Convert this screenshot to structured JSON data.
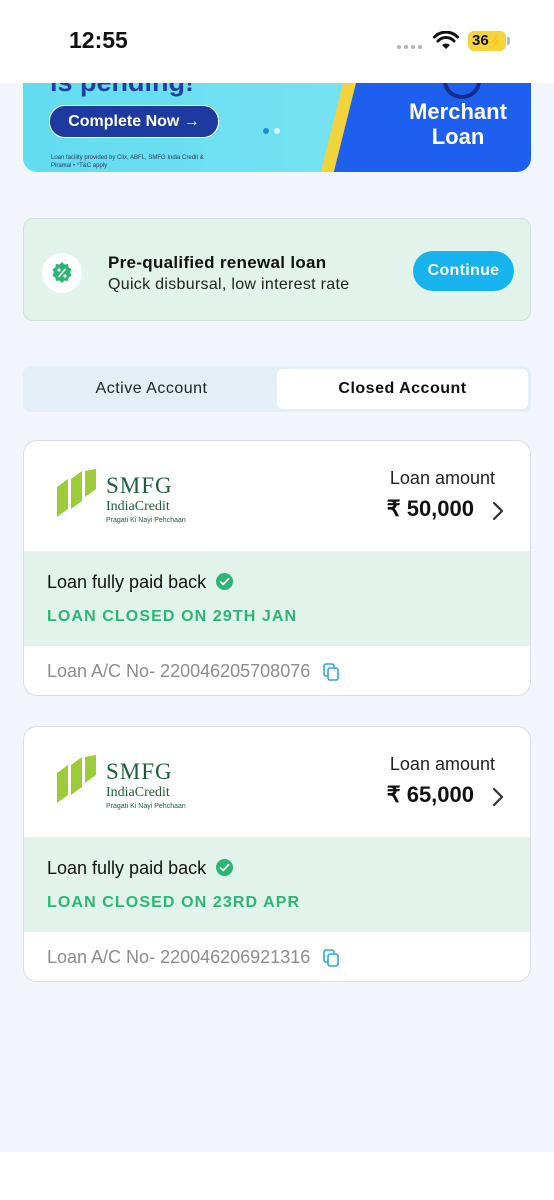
{
  "status_bar": {
    "time": "12:55",
    "battery": "36"
  },
  "banner": {
    "heading": "is pending!",
    "cta_label": "Complete Now →",
    "disclaimer": "Loan facility provided by Clix, ABFL, SMFG India Credit & Piramal • *T&C apply",
    "promo_title": "Merchant Loan"
  },
  "renewal": {
    "title": "Pre-qualified renewal loan",
    "subtitle": "Quick disbursal, low interest rate",
    "continue_label": "Continue"
  },
  "tabs": [
    {
      "label": "Active Account",
      "active": false
    },
    {
      "label": "Closed Account",
      "active": true
    }
  ],
  "loans": [
    {
      "lender_name": "SMFG",
      "lender_sub": "IndiaCredit",
      "lender_tagline": "Pragati Ki Nayi Pehchaan",
      "amount_label": "Loan amount",
      "amount": "₹ 50,000",
      "status": "Loan fully paid back",
      "closed_on": "LOAN CLOSED ON 29TH JAN",
      "account": "Loan A/C No- 220046205708076"
    },
    {
      "lender_name": "SMFG",
      "lender_sub": "IndiaCredit",
      "lender_tagline": "Pragati Ki Nayi Pehchaan",
      "amount_label": "Loan amount",
      "amount": "₹ 65,000",
      "status": "Loan fully paid back",
      "closed_on": "LOAN CLOSED ON 23RD APR",
      "account": "Loan A/C No- 220046206921316"
    }
  ],
  "colors": {
    "accent": "#17b3ee",
    "success": "#2bb673",
    "success_bg": "#e1f3ea",
    "brand_green": "#1d5f3a",
    "logo_green": "#9ccc3a"
  },
  "icons": [
    "wifi-icon",
    "battery-icon",
    "discount-badge-icon",
    "chevron-right-icon",
    "check-circle-icon",
    "copy-icon"
  ]
}
